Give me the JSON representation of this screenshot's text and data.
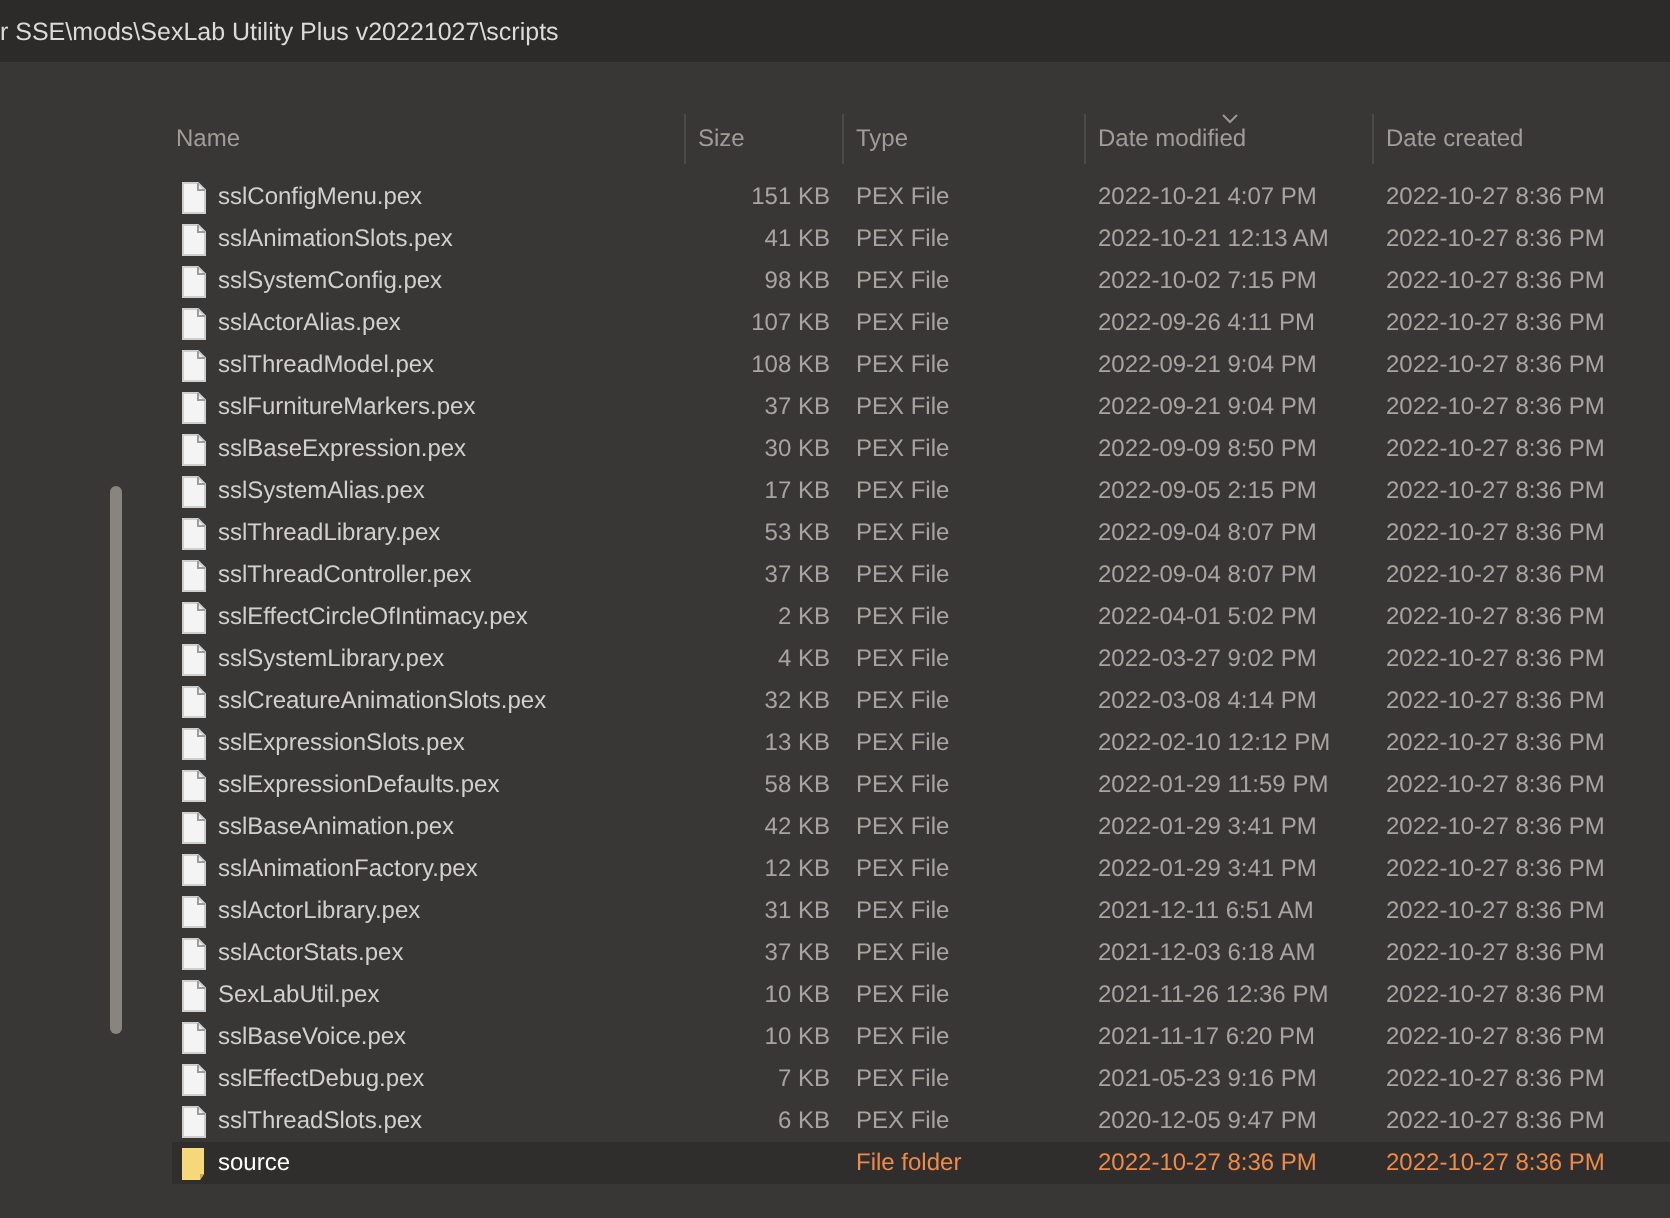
{
  "address_bar": {
    "path": "r SSE\\mods\\SexLab Utility Plus v20221027\\scripts"
  },
  "table": {
    "columns": [
      {
        "label": "Name",
        "sorted": false
      },
      {
        "label": "Size",
        "sorted": false
      },
      {
        "label": "Type",
        "sorted": false
      },
      {
        "label": "Date modified",
        "sorted": true
      },
      {
        "label": "Date created",
        "sorted": false
      }
    ],
    "rows": [
      {
        "kind": "file",
        "name": "sslConfigMenu.pex",
        "size": "151 KB",
        "type": "PEX File",
        "date_modified": "2022-10-21 4:07 PM",
        "date_created": "2022-10-27 8:36 PM",
        "selected": false
      },
      {
        "kind": "file",
        "name": "sslAnimationSlots.pex",
        "size": "41 KB",
        "type": "PEX File",
        "date_modified": "2022-10-21 12:13 AM",
        "date_created": "2022-10-27 8:36 PM",
        "selected": false
      },
      {
        "kind": "file",
        "name": "sslSystemConfig.pex",
        "size": "98 KB",
        "type": "PEX File",
        "date_modified": "2022-10-02 7:15 PM",
        "date_created": "2022-10-27 8:36 PM",
        "selected": false
      },
      {
        "kind": "file",
        "name": "sslActorAlias.pex",
        "size": "107 KB",
        "type": "PEX File",
        "date_modified": "2022-09-26 4:11 PM",
        "date_created": "2022-10-27 8:36 PM",
        "selected": false
      },
      {
        "kind": "file",
        "name": "sslThreadModel.pex",
        "size": "108 KB",
        "type": "PEX File",
        "date_modified": "2022-09-21 9:04 PM",
        "date_created": "2022-10-27 8:36 PM",
        "selected": false
      },
      {
        "kind": "file",
        "name": "sslFurnitureMarkers.pex",
        "size": "37 KB",
        "type": "PEX File",
        "date_modified": "2022-09-21 9:04 PM",
        "date_created": "2022-10-27 8:36 PM",
        "selected": false
      },
      {
        "kind": "file",
        "name": "sslBaseExpression.pex",
        "size": "30 KB",
        "type": "PEX File",
        "date_modified": "2022-09-09 8:50 PM",
        "date_created": "2022-10-27 8:36 PM",
        "selected": false
      },
      {
        "kind": "file",
        "name": "sslSystemAlias.pex",
        "size": "17 KB",
        "type": "PEX File",
        "date_modified": "2022-09-05 2:15 PM",
        "date_created": "2022-10-27 8:36 PM",
        "selected": false
      },
      {
        "kind": "file",
        "name": "sslThreadLibrary.pex",
        "size": "53 KB",
        "type": "PEX File",
        "date_modified": "2022-09-04 8:07 PM",
        "date_created": "2022-10-27 8:36 PM",
        "selected": false
      },
      {
        "kind": "file",
        "name": "sslThreadController.pex",
        "size": "37 KB",
        "type": "PEX File",
        "date_modified": "2022-09-04 8:07 PM",
        "date_created": "2022-10-27 8:36 PM",
        "selected": false
      },
      {
        "kind": "file",
        "name": "sslEffectCircleOfIntimacy.pex",
        "size": "2 KB",
        "type": "PEX File",
        "date_modified": "2022-04-01 5:02 PM",
        "date_created": "2022-10-27 8:36 PM",
        "selected": false
      },
      {
        "kind": "file",
        "name": "sslSystemLibrary.pex",
        "size": "4 KB",
        "type": "PEX File",
        "date_modified": "2022-03-27 9:02 PM",
        "date_created": "2022-10-27 8:36 PM",
        "selected": false
      },
      {
        "kind": "file",
        "name": "sslCreatureAnimationSlots.pex",
        "size": "32 KB",
        "type": "PEX File",
        "date_modified": "2022-03-08 4:14 PM",
        "date_created": "2022-10-27 8:36 PM",
        "selected": false
      },
      {
        "kind": "file",
        "name": "sslExpressionSlots.pex",
        "size": "13 KB",
        "type": "PEX File",
        "date_modified": "2022-02-10 12:12 PM",
        "date_created": "2022-10-27 8:36 PM",
        "selected": false
      },
      {
        "kind": "file",
        "name": "sslExpressionDefaults.pex",
        "size": "58 KB",
        "type": "PEX File",
        "date_modified": "2022-01-29 11:59 PM",
        "date_created": "2022-10-27 8:36 PM",
        "selected": false
      },
      {
        "kind": "file",
        "name": "sslBaseAnimation.pex",
        "size": "42 KB",
        "type": "PEX File",
        "date_modified": "2022-01-29 3:41 PM",
        "date_created": "2022-10-27 8:36 PM",
        "selected": false
      },
      {
        "kind": "file",
        "name": "sslAnimationFactory.pex",
        "size": "12 KB",
        "type": "PEX File",
        "date_modified": "2022-01-29 3:41 PM",
        "date_created": "2022-10-27 8:36 PM",
        "selected": false
      },
      {
        "kind": "file",
        "name": "sslActorLibrary.pex",
        "size": "31 KB",
        "type": "PEX File",
        "date_modified": "2021-12-11 6:51 AM",
        "date_created": "2022-10-27 8:36 PM",
        "selected": false
      },
      {
        "kind": "file",
        "name": "sslActorStats.pex",
        "size": "37 KB",
        "type": "PEX File",
        "date_modified": "2021-12-03 6:18 AM",
        "date_created": "2022-10-27 8:36 PM",
        "selected": false
      },
      {
        "kind": "file",
        "name": "SexLabUtil.pex",
        "size": "10 KB",
        "type": "PEX File",
        "date_modified": "2021-11-26 12:36 PM",
        "date_created": "2022-10-27 8:36 PM",
        "selected": false
      },
      {
        "kind": "file",
        "name": "sslBaseVoice.pex",
        "size": "10 KB",
        "type": "PEX File",
        "date_modified": "2021-11-17 6:20 PM",
        "date_created": "2022-10-27 8:36 PM",
        "selected": false
      },
      {
        "kind": "file",
        "name": "sslEffectDebug.pex",
        "size": "7 KB",
        "type": "PEX File",
        "date_modified": "2021-05-23 9:16 PM",
        "date_created": "2022-10-27 8:36 PM",
        "selected": false
      },
      {
        "kind": "file",
        "name": "sslThreadSlots.pex",
        "size": "6 KB",
        "type": "PEX File",
        "date_modified": "2020-12-05 9:47 PM",
        "date_created": "2022-10-27 8:36 PM",
        "selected": false
      },
      {
        "kind": "folder",
        "name": "source",
        "type": "File folder",
        "date_modified": "2022-10-27 8:36 PM",
        "date_created": "2022-10-27 8:36 PM",
        "selected": true
      }
    ]
  }
}
